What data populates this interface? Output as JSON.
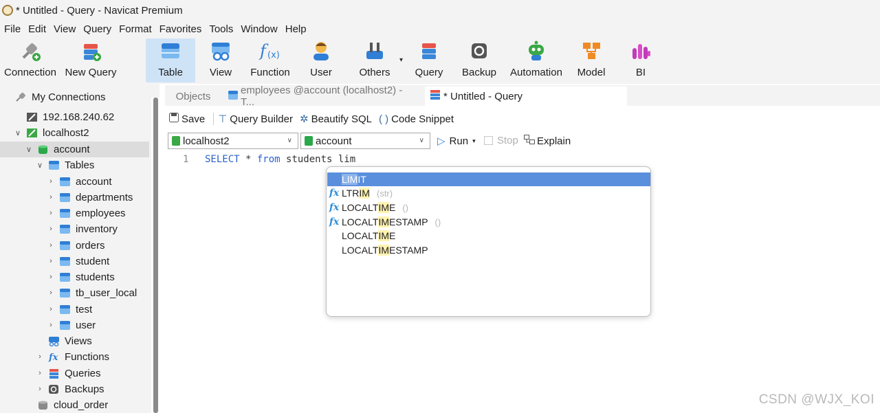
{
  "window": {
    "title": "* Untitled - Query - Navicat Premium"
  },
  "menu": [
    "File",
    "Edit",
    "View",
    "Query",
    "Format",
    "Favorites",
    "Tools",
    "Window",
    "Help"
  ],
  "ribbon": [
    {
      "label": "Connection",
      "icon": "connection-plug-icon"
    },
    {
      "label": "New Query",
      "icon": "new-query-icon"
    },
    {
      "label": "Table",
      "icon": "table-icon",
      "active": true
    },
    {
      "label": "View",
      "icon": "view-icon"
    },
    {
      "label": "Function",
      "icon": "function-icon"
    },
    {
      "label": "User",
      "icon": "user-icon"
    },
    {
      "label": "Others",
      "icon": "others-tools-icon"
    },
    {
      "label": "Query",
      "icon": "query-icon"
    },
    {
      "label": "Backup",
      "icon": "backup-icon"
    },
    {
      "label": "Automation",
      "icon": "automation-robot-icon"
    },
    {
      "label": "Model",
      "icon": "model-icon"
    },
    {
      "label": "BI",
      "icon": "bi-icon"
    }
  ],
  "sidebar": {
    "header": "My Connections",
    "items": [
      {
        "label": "192.168.240.62",
        "icon": "connection-icon"
      },
      {
        "label": "localhost2",
        "icon": "connection-open-icon"
      },
      {
        "label": "account",
        "icon": "database-icon"
      },
      {
        "label": "Tables",
        "icon": "tables-group-icon"
      },
      {
        "label": "account",
        "icon": "table-icon"
      },
      {
        "label": "departments",
        "icon": "table-icon"
      },
      {
        "label": "employees",
        "icon": "table-icon"
      },
      {
        "label": "inventory",
        "icon": "table-icon"
      },
      {
        "label": "orders",
        "icon": "table-icon"
      },
      {
        "label": "student",
        "icon": "table-icon"
      },
      {
        "label": "students",
        "icon": "table-icon"
      },
      {
        "label": "tb_user_local",
        "icon": "table-icon"
      },
      {
        "label": "test",
        "icon": "table-icon"
      },
      {
        "label": "user",
        "icon": "table-icon"
      },
      {
        "label": "Views",
        "icon": "views-icon"
      },
      {
        "label": "Functions",
        "icon": "functions-icon"
      },
      {
        "label": "Queries",
        "icon": "queries-icon"
      },
      {
        "label": "Backups",
        "icon": "backups-icon"
      },
      {
        "label": "cloud_order",
        "icon": "database-grey-icon"
      }
    ]
  },
  "tabs": [
    {
      "label": "Objects"
    },
    {
      "label": "employees @account (localhost2) - T..."
    },
    {
      "label": "* Untitled - Query"
    }
  ],
  "toolbar": {
    "save": "Save",
    "query_builder": "Query Builder",
    "beautify": "Beautify SQL",
    "snippet": "Code Snippet",
    "connection": "localhost2",
    "database": "account",
    "run": "Run",
    "stop": "Stop",
    "explain": "Explain"
  },
  "editor": {
    "line_number": "1",
    "kw_select": "SELECT",
    "star": " * ",
    "kw_from": "from",
    "rest": " students lim"
  },
  "autocomplete": [
    {
      "pre": "LIM",
      "post": "IT",
      "args": "",
      "fx": false,
      "selected": true
    },
    {
      "pre": "LTR",
      "hl": "IM",
      "post": "",
      "args": "(str)",
      "fx": true
    },
    {
      "pre": "LOCALT",
      "hl": "IM",
      "post": "E",
      "args": "()",
      "fx": true
    },
    {
      "pre": "LOCALT",
      "hl": "IM",
      "post": "ESTAMP",
      "args": "()",
      "fx": true
    },
    {
      "pre": "LOCALT",
      "hl": "IM",
      "post": "E",
      "args": "",
      "fx": false
    },
    {
      "pre": "LOCALT",
      "hl": "IM",
      "post": "ESTAMP",
      "args": "",
      "fx": false
    }
  ],
  "watermark": "CSDN @WJX_KOI"
}
